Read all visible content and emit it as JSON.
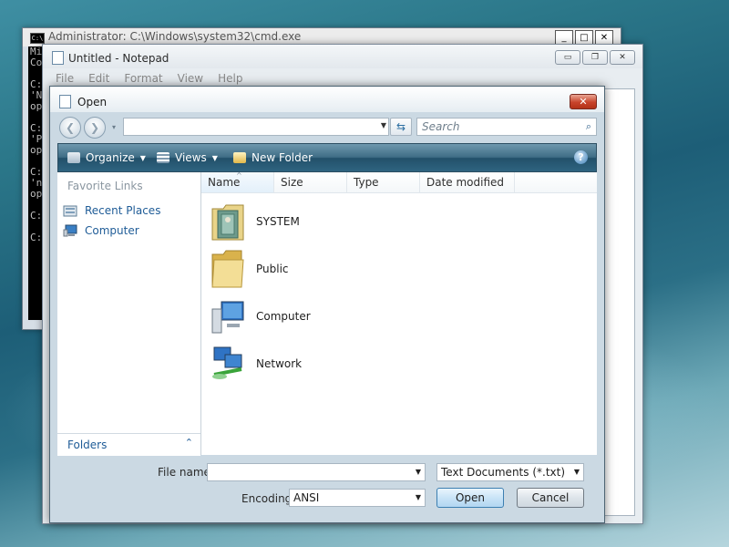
{
  "desktop": {
    "colors": {
      "accent": "#2b7789"
    }
  },
  "cmd_window": {
    "title": "Administrator: C:\\Windows\\system32\\cmd.exe",
    "icon": "console-icon",
    "icon_text": "C:\\",
    "controls": [
      "_",
      "□",
      "✕"
    ],
    "lines": [
      "Mi",
      "Co",
      "",
      "C:",
      "'N",
      "op",
      "",
      "C:",
      "'P",
      "op",
      "",
      "C:",
      "'n",
      "op",
      "",
      "C:",
      "",
      "C:"
    ]
  },
  "notepad": {
    "title": "Untitled - Notepad",
    "icon": "notepad-icon",
    "menu": [
      "File",
      "Edit",
      "Format",
      "View",
      "Help"
    ],
    "controls": [
      "▭",
      "❐",
      "✕"
    ]
  },
  "dialog": {
    "title": "Open",
    "close_label": "✕",
    "nav": {
      "back": "❮",
      "forward": "❯",
      "address": "",
      "refresh": "⇆",
      "search_placeholder": "Search",
      "search_icon": "⌕"
    },
    "toolbar": {
      "organize": "Organize",
      "views": "Views",
      "new_folder": "New Folder",
      "help": "?"
    },
    "favorite_links": {
      "heading": "Favorite Links",
      "items": [
        "Recent Places",
        "Computer"
      ]
    },
    "folders_label": "Folders",
    "columns": [
      "Name",
      "Size",
      "Type",
      "Date modified"
    ],
    "items": [
      {
        "name": "SYSTEM",
        "icon": "user-folder-icon"
      },
      {
        "name": "Public",
        "icon": "folder-icon"
      },
      {
        "name": "Computer",
        "icon": "computer-icon"
      },
      {
        "name": "Network",
        "icon": "network-icon"
      }
    ],
    "file_name": {
      "label": "File name:",
      "value": ""
    },
    "file_type": {
      "selected": "Text Documents (*.txt)"
    },
    "encoding": {
      "label": "Encoding:",
      "selected": "ANSI"
    },
    "open_button": "Open",
    "cancel_button": "Cancel"
  }
}
